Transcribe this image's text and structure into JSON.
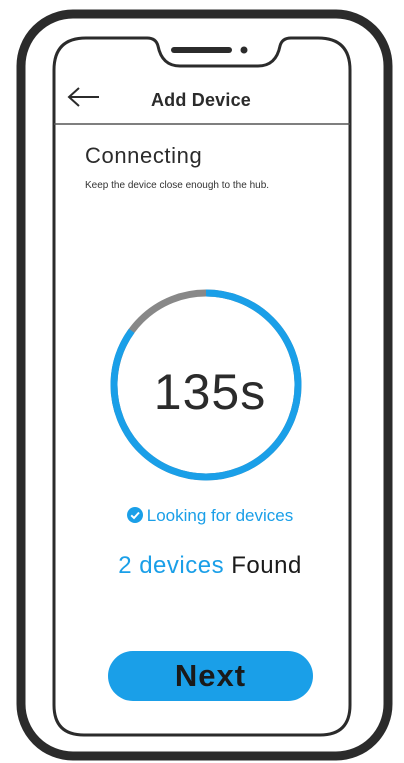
{
  "header": {
    "title": "Add Device",
    "back_icon": "arrow-left-icon"
  },
  "main": {
    "title": "Connecting",
    "subtitle": "Keep the device close enough to the hub.",
    "timer": {
      "label": "135s",
      "progress_fraction": 0.85
    },
    "status": {
      "icon": "check-circle-icon",
      "label": "Looking for devices"
    },
    "found": {
      "count_label": "2 devices",
      "suffix_label": "Found"
    },
    "next_label": "Next"
  },
  "colors": {
    "accent": "#1a9fe8",
    "progress_track": "#888888",
    "frame": "#2b2b2b"
  }
}
